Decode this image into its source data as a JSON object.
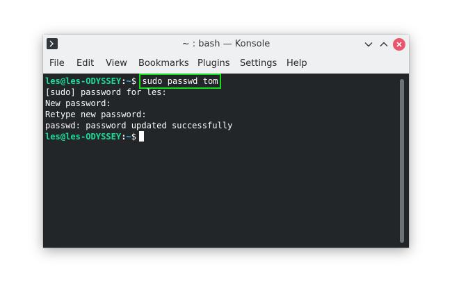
{
  "window": {
    "title": "~ : bash — Konsole"
  },
  "menu": {
    "items": [
      "File",
      "Edit",
      "View",
      "Bookmarks",
      "Plugins",
      "Settings",
      "Help"
    ]
  },
  "terminal": {
    "prompt_user_host": "les@les-ODYSSEY",
    "prompt_separator": ":",
    "prompt_path": "~",
    "prompt_symbol": "$",
    "command": "sudo passwd tom",
    "output": [
      "[sudo] password for les:",
      "New password:",
      "Retype new password:",
      "passwd: password updated successfully"
    ]
  },
  "colors": {
    "terminal_bg": "#232629",
    "prompt_user": "#1cdc9a",
    "prompt_path": "#3daee9",
    "highlight": "#11e01a",
    "close_button": "#e9556b"
  },
  "icons": {
    "app": "konsole-icon",
    "minimize": "chevron-down-icon",
    "maximize": "chevron-up-icon",
    "close": "close-icon"
  }
}
